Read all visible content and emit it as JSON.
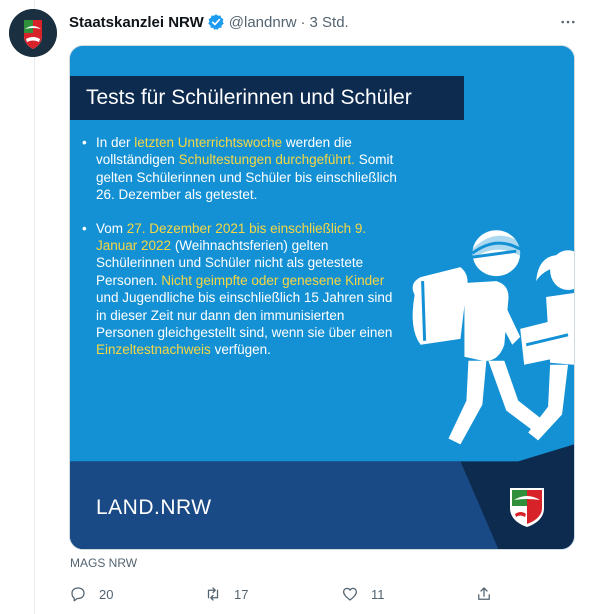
{
  "tweet": {
    "author_name": "Staatskanzlei NRW",
    "handle": "@landnrw",
    "separator": "·",
    "time": "3 Std.",
    "more_icon": "more-horizontal-icon",
    "verified_icon": "verified-badge-icon",
    "verified_color": "#1d9bf0"
  },
  "graphic": {
    "title": "Tests für Schülerinnen und Schüler",
    "bullet1": {
      "t1": "In der ",
      "h1": "letzten Unterrichtswoche",
      "t2": " werden die vollständigen ",
      "h2": "Schultestungen durchgeführt.",
      "t3": " Somit gelten Schülerinnen und Schüler bis einschließlich 26. Dezember als getestet."
    },
    "bullet2": {
      "t1": "Vom ",
      "h1": "27. Dezember 2021 bis einschließlich 9. Januar 2022",
      "t2": " (Weihnachtsferien) gelten Schülerinnen und Schüler nicht als getestete Personen. ",
      "h2": "Nicht geimpfte oder genesene Kinder",
      "t3": " und Jugendliche bis einschließlich 15 Jahren sind in dieser Zeit nur dann den immunisierten Personen gleichgestellt sind, wenn sie über einen ",
      "h3": "Einzeltestnachweis",
      "t4": " verfügen."
    },
    "footer_brand": "LAND.NRW",
    "colors": {
      "background": "#1491d4",
      "title_box": "#0d2a4f",
      "highlight": "#f6d743",
      "footer": "#0d2a4f"
    }
  },
  "media_credit": "MAGS NRW",
  "actions": {
    "reply_count": "20",
    "retweet_count": "17",
    "like_count": "11",
    "reply_icon": "reply-icon",
    "retweet_icon": "retweet-icon",
    "like_icon": "heart-icon",
    "share_icon": "share-icon"
  }
}
